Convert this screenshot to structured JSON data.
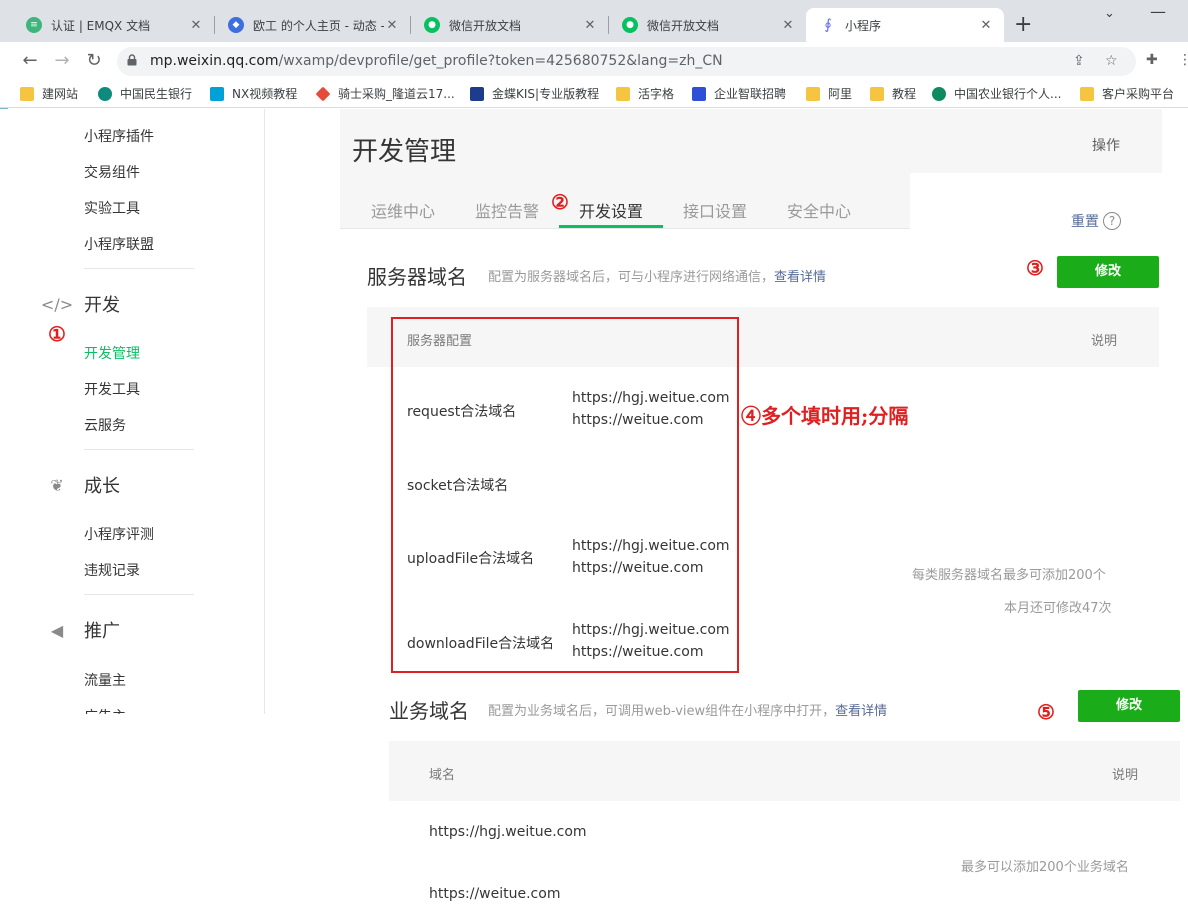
{
  "browser": {
    "tabs": [
      {
        "title": "认证 | EMQX 文档",
        "icon_color": "#3eb57c"
      },
      {
        "title": "欧工 的个人主页 - 动态 -",
        "icon_color": "#3d6fe0"
      },
      {
        "title": "微信开放文档",
        "icon_color": "#07c160"
      },
      {
        "title": "微信开放文档",
        "icon_color": "#07c160"
      },
      {
        "title": "小程序",
        "icon_color": "#6467f0"
      }
    ],
    "active_tab_index": 4,
    "url_host": "mp.weixin.qq.com",
    "url_path": "/wxamp/devprofile/get_profile?token=425680752&lang=zh_CN",
    "bookmarks": [
      {
        "label": "建网站",
        "icon": "folder-icon",
        "color": "#f5c542"
      },
      {
        "label": "中国民生银行",
        "icon": "cmbc-icon",
        "color": "#0f8a7e"
      },
      {
        "label": "NX视频教程",
        "icon": "bilibili-icon",
        "color": "#00a1d6"
      },
      {
        "label": "骑士采购_隆道云17...",
        "icon": "diamond-icon",
        "color": "#e64a3b"
      },
      {
        "label": "金蝶KIS|专业版教程",
        "icon": "kingdee-icon",
        "color": "#1e3c8c"
      },
      {
        "label": "活字格",
        "icon": "folder-icon",
        "color": "#f5c542"
      },
      {
        "label": "企业智联招聘",
        "icon": "zhilian-icon",
        "color": "#2e4fd6"
      },
      {
        "label": "阿里",
        "icon": "folder-icon",
        "color": "#f5c542"
      },
      {
        "label": "教程",
        "icon": "folder-icon",
        "color": "#f5c542"
      },
      {
        "label": "中国农业银行个人...",
        "icon": "abc-icon",
        "color": "#0f8a5f"
      },
      {
        "label": "客户采购平台",
        "icon": "folder-icon",
        "color": "#f5c542"
      }
    ]
  },
  "sidebar": {
    "items_top": [
      "小程序插件",
      "交易组件",
      "实验工具",
      "小程序联盟"
    ],
    "sections": [
      {
        "title": "开发",
        "icon": "code-icon",
        "items": [
          "开发管理",
          "开发工具",
          "云服务"
        ]
      },
      {
        "title": "成长",
        "icon": "sprout-icon",
        "items": [
          "小程序评测",
          "违规记录"
        ]
      },
      {
        "title": "推广",
        "icon": "megaphone-icon",
        "items": [
          "流量主",
          "广告主"
        ]
      }
    ],
    "active_item": "开发管理"
  },
  "header": {
    "title": "开发管理",
    "operation": "操作"
  },
  "tabs": [
    "运维中心",
    "监控告警",
    "开发设置",
    "接口设置",
    "安全中心"
  ],
  "active_tab": "开发设置",
  "reset": {
    "label": "重置",
    "help": "?"
  },
  "server_domain": {
    "title": "服务器域名",
    "desc": "配置为服务器域名后，可与小程序进行网络通信，",
    "desc_link": "查看详情",
    "edit_label": "修改",
    "col_config": "服务器配置",
    "col_note": "说明",
    "rows": [
      {
        "label": "request合法域名",
        "values": [
          "https://hgj.weitue.com",
          "https://weitue.com"
        ]
      },
      {
        "label": "socket合法域名",
        "values": []
      },
      {
        "label": "uploadFile合法域名",
        "values": [
          "https://hgj.weitue.com",
          "https://weitue.com"
        ]
      },
      {
        "label": "downloadFile合法域名",
        "values": [
          "https://hgj.weitue.com",
          "https://weitue.com"
        ]
      }
    ],
    "note1": "每类服务器域名最多可添加200个",
    "note2": "本月还可修改47次"
  },
  "business_domain": {
    "title": "业务域名",
    "desc": "配置为业务域名后，可调用web-view组件在小程序中打开，",
    "desc_link": "查看详情",
    "edit_label": "修改",
    "col_domain": "域名",
    "col_note": "说明",
    "rows": [
      "https://hgj.weitue.com",
      "https://weitue.com"
    ],
    "note": "最多可以添加200个业务域名"
  },
  "annotations": {
    "n1": "①",
    "n2": "②",
    "n3": "③",
    "n4_text": "④多个填时用;分隔",
    "n5": "⑤"
  },
  "colors": {
    "accent_green": "#07c160",
    "button_green": "#1aad19",
    "link_blue": "#576b95",
    "annotation_red": "#e02020"
  }
}
